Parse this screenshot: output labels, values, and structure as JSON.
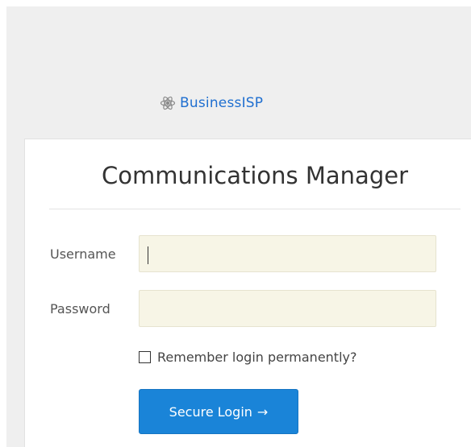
{
  "brand": {
    "icon": "atom-logo-icon",
    "name": "BusinessISP"
  },
  "login": {
    "title": "Communications Manager",
    "username_label": "Username",
    "username_value": "",
    "password_label": "Password",
    "password_value": "",
    "remember_label": "Remember login permanently?",
    "remember_checked": false,
    "submit_label": "Secure Login",
    "submit_arrow": "→"
  },
  "colors": {
    "brand": "#1f6fd0",
    "button": "#1a84d8",
    "input_bg": "#f7f5e6",
    "page_bg": "#efefef"
  }
}
